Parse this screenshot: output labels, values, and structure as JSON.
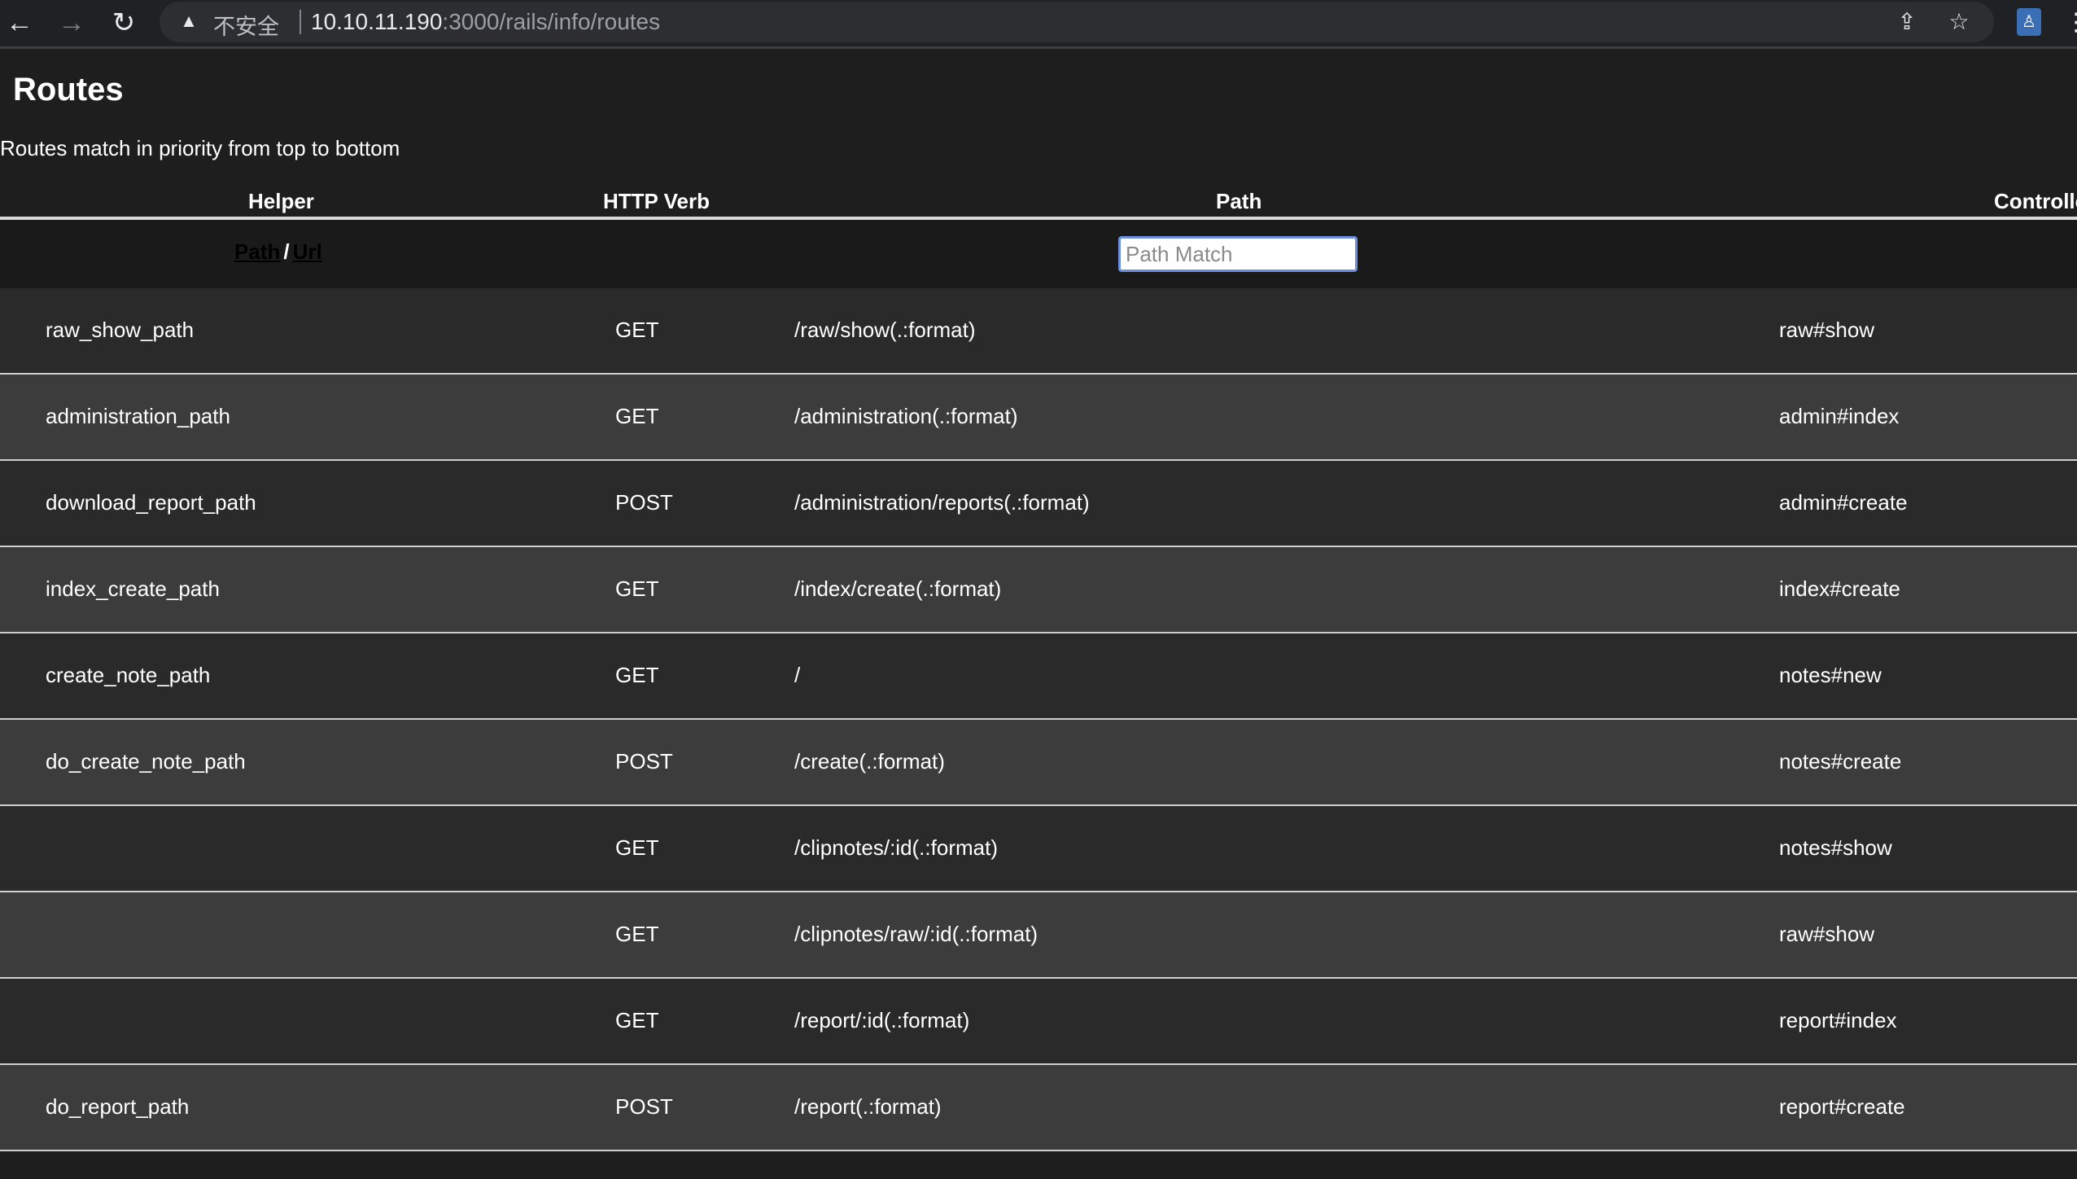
{
  "browser": {
    "security_label": "不安全",
    "url_host": "10.10.11.190",
    "url_rest": ":3000/rails/info/routes"
  },
  "page": {
    "title": "Routes",
    "subtitle": "Routes match in priority from top to bottom"
  },
  "table": {
    "headers": {
      "helper": "Helper",
      "verb": "HTTP Verb",
      "path": "Path",
      "controller": "Controller#Action"
    },
    "filter": {
      "path_link": "Path",
      "separator": "/",
      "url_link": "Url",
      "path_match_placeholder": "Path Match"
    },
    "rows": [
      {
        "helper": "raw_show_path",
        "verb": "GET",
        "path": "/raw/show(.:format)",
        "controller": "raw#show"
      },
      {
        "helper": "administration_path",
        "verb": "GET",
        "path": "/administration(.:format)",
        "controller": "admin#index"
      },
      {
        "helper": "download_report_path",
        "verb": "POST",
        "path": "/administration/reports(.:format)",
        "controller": "admin#create"
      },
      {
        "helper": "index_create_path",
        "verb": "GET",
        "path": "/index/create(.:format)",
        "controller": "index#create"
      },
      {
        "helper": "create_note_path",
        "verb": "GET",
        "path": "/",
        "controller": "notes#new"
      },
      {
        "helper": "do_create_note_path",
        "verb": "POST",
        "path": "/create(.:format)",
        "controller": "notes#create"
      },
      {
        "helper": "",
        "verb": "GET",
        "path": "/clipnotes/:id(.:format)",
        "controller": "notes#show"
      },
      {
        "helper": "",
        "verb": "GET",
        "path": "/clipnotes/raw/:id(.:format)",
        "controller": "raw#show"
      },
      {
        "helper": "",
        "verb": "GET",
        "path": "/report/:id(.:format)",
        "controller": "report#index"
      },
      {
        "helper": "do_report_path",
        "verb": "POST",
        "path": "/report(.:format)",
        "controller": "report#create"
      }
    ]
  }
}
